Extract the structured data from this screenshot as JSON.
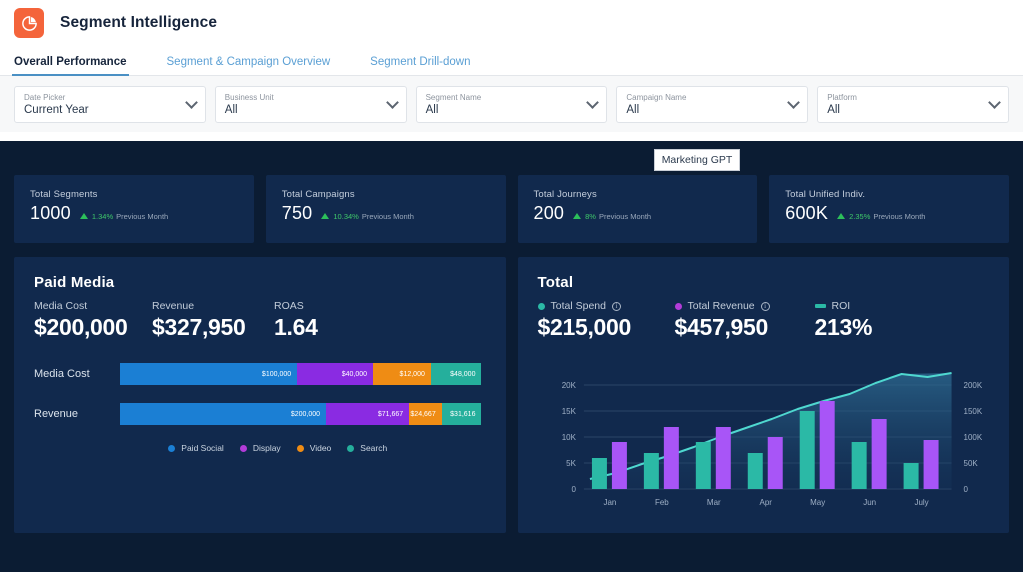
{
  "header": {
    "title": "Segment Intelligence",
    "logo_icon": "pie-chart-icon",
    "logo_color": "#f4643b"
  },
  "tabs": [
    {
      "label": "Overall Performance",
      "active": true
    },
    {
      "label": "Segment & Campaign Overview",
      "active": false
    },
    {
      "label": "Segment Drill-down",
      "active": false
    }
  ],
  "filters": [
    {
      "label": "Date Picker",
      "value": "Current Year"
    },
    {
      "label": "Business Unit",
      "value": "All"
    },
    {
      "label": "Segment Name",
      "value": "All"
    },
    {
      "label": "Campaign Name",
      "value": "All"
    },
    {
      "label": "Platform",
      "value": "All"
    }
  ],
  "popup": {
    "label": "Marketing GPT"
  },
  "kpis": [
    {
      "label": "Total Segments",
      "value": "1000",
      "delta": "1.34%",
      "delta_note": "Previous Month",
      "direction": "up"
    },
    {
      "label": "Total Campaigns",
      "value": "750",
      "delta": "10.34%",
      "delta_note": "Previous Month",
      "direction": "up"
    },
    {
      "label": "Total Journeys",
      "value": "200",
      "delta": "8%",
      "delta_note": "Previous Month",
      "direction": "up"
    },
    {
      "label": "Total Unified Indiv.",
      "value": "600K",
      "delta": "2.35%",
      "delta_note": "Previous Month",
      "direction": "up"
    }
  ],
  "paid_media": {
    "title": "Paid Media",
    "metrics": [
      {
        "label": "Media Cost",
        "value": "$200,000"
      },
      {
        "label": "Revenue",
        "value": "$327,950"
      },
      {
        "label": "ROAS",
        "value": "1.64"
      }
    ]
  },
  "total_panel": {
    "title": "Total",
    "metrics": [
      {
        "label": "Total Spend",
        "value": "$215,000",
        "marker": "dot",
        "color": "#2bb9a6",
        "info": true
      },
      {
        "label": "Total Revenue",
        "value": "$457,950",
        "marker": "dot",
        "color": "#b23cd8",
        "info": true
      },
      {
        "label": "ROI",
        "value": "213%",
        "marker": "dash",
        "color": "#2bb9a6",
        "info": false
      }
    ]
  },
  "chart_data": [
    {
      "type": "bar",
      "title": "Paid Media Cost & Revenue by Channel",
      "orientation": "horizontal",
      "stacked": true,
      "categories": [
        "Media Cost",
        "Revenue"
      ],
      "series": [
        {
          "name": "Paid Social",
          "color": "#1b7fd4",
          "values": [
            100000,
            200000
          ],
          "labels": [
            "$100,000",
            "$200,000"
          ],
          "widths_pct": [
            49,
            57
          ]
        },
        {
          "name": "Display",
          "color": "#8a2be2",
          "values": [
            40000,
            71667
          ],
          "labels": [
            "$40,000",
            "$71,667"
          ],
          "widths_pct": [
            21,
            23
          ]
        },
        {
          "name": "Video",
          "color": "#ef8c14",
          "values": [
            12000,
            24667
          ],
          "labels": [
            "$12,000",
            "$24,667"
          ],
          "widths_pct": [
            16,
            9
          ]
        },
        {
          "name": "Search",
          "color": "#25af9c",
          "values": [
            48000,
            31616
          ],
          "labels": [
            "$48,000",
            "$31,616"
          ],
          "widths_pct": [
            14,
            11
          ]
        }
      ],
      "legend": [
        "Paid Social",
        "Display",
        "Video",
        "Search"
      ],
      "legend_position": "bottom"
    },
    {
      "type": "bar",
      "title": "Total Spend, Revenue and ROI by Month",
      "categories": [
        "Jan",
        "Feb",
        "Mar",
        "Apr",
        "May",
        "Jun",
        "July"
      ],
      "xlabel": "",
      "ylabel": "",
      "yticks_left": [
        "0",
        "5K",
        "10K",
        "15K",
        "20K"
      ],
      "ylim_left": [
        0,
        20000
      ],
      "yticks_right": [
        "0",
        "50K",
        "100K",
        "150K",
        "200K"
      ],
      "ylim_right": [
        0,
        200000
      ],
      "grid": true,
      "series": [
        {
          "name": "Total Spend",
          "color": "#2bb9a6",
          "axis": "left",
          "values": [
            6000,
            7000,
            9000,
            7000,
            15000,
            9000,
            5000
          ]
        },
        {
          "name": "Total Revenue",
          "color": "#a855f7",
          "axis": "left",
          "values": [
            9000,
            12000,
            12000,
            10000,
            17000,
            13500,
            9500
          ]
        },
        {
          "name": "ROI",
          "color": "#4fd8d0",
          "type": "line",
          "axis": "right",
          "values": [
            20000,
            48000,
            80000,
            118000,
            155000,
            185000,
            222000
          ]
        }
      ],
      "legend": [
        "Total Spend",
        "Total Revenue",
        "ROI"
      ],
      "legend_position": "top"
    }
  ]
}
